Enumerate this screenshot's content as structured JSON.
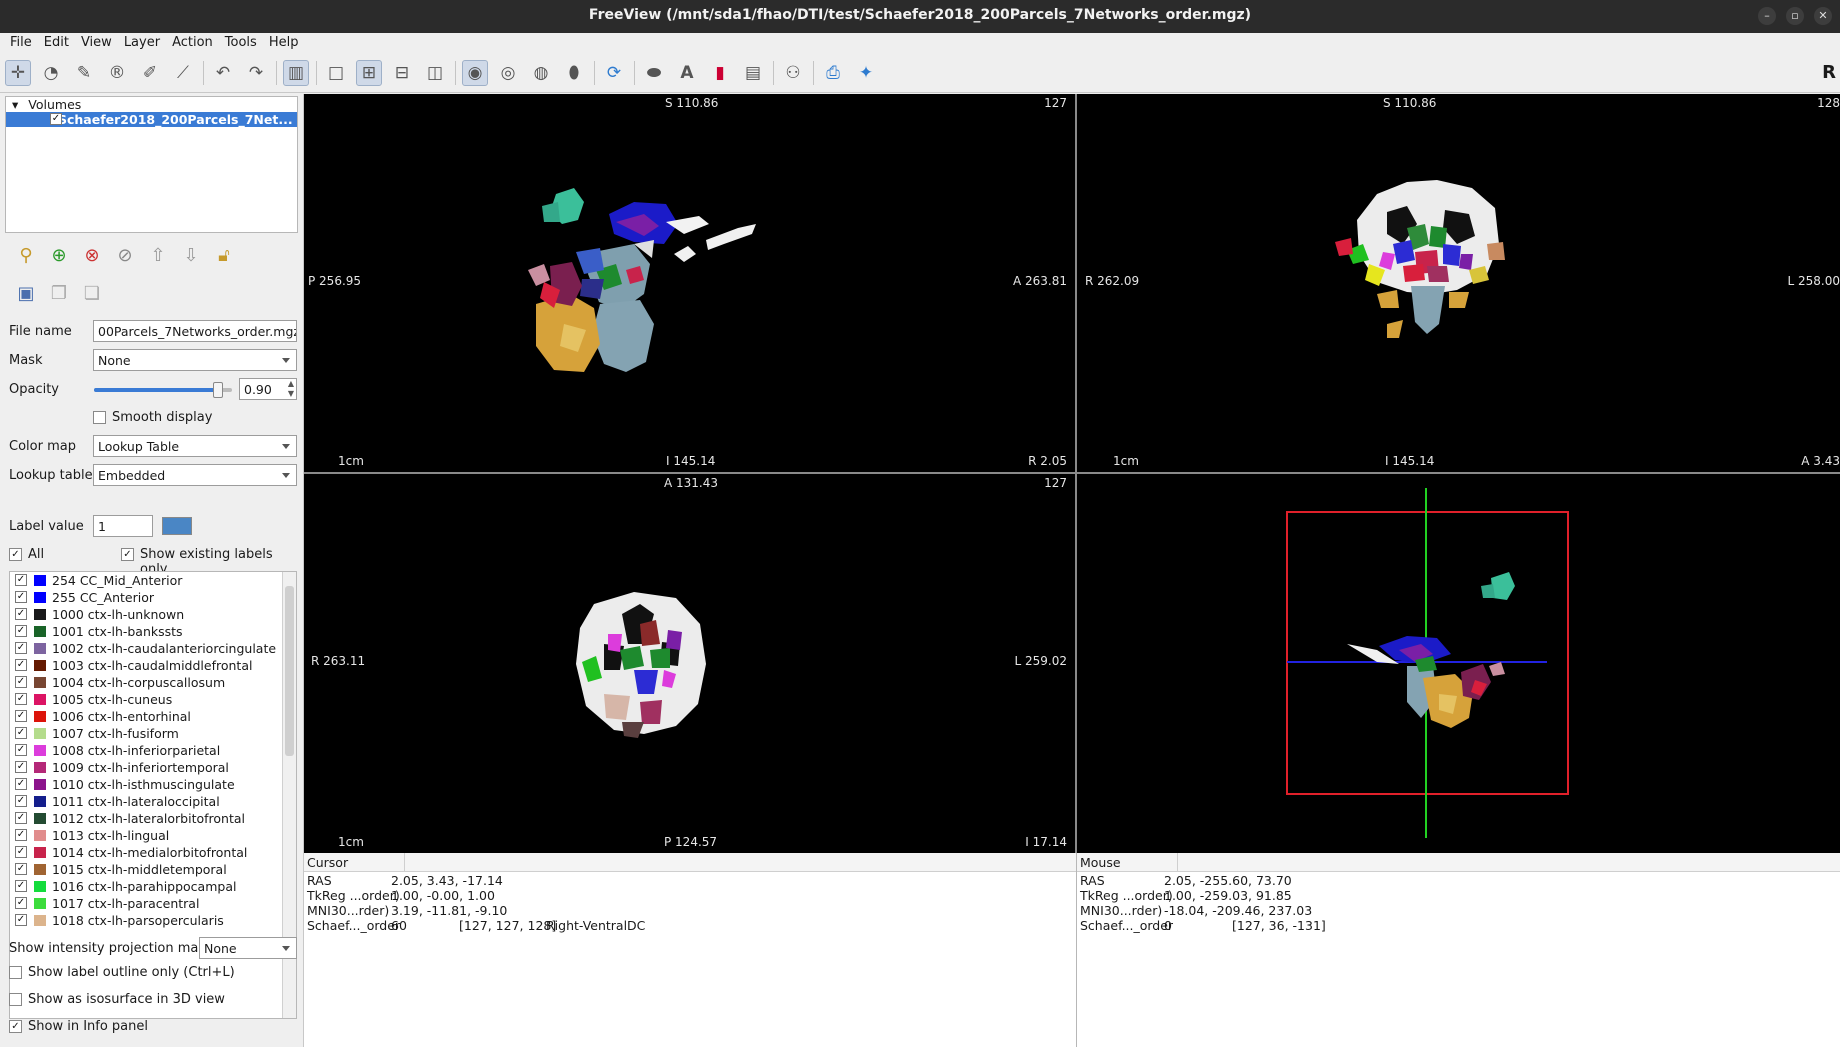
{
  "window": {
    "title": "FreeView (/mnt/sda1/fhao/DTI/test/Schaefer2018_200Parcels_7Networks_order.mgz)"
  },
  "menu": [
    "File",
    "Edit",
    "View",
    "Layer",
    "Action",
    "Tools",
    "Help"
  ],
  "toolbar": {
    "right_label": "R"
  },
  "layers": {
    "group": "Volumes",
    "selected": "Schaefer2018_200Parcels_7Net..."
  },
  "props": {
    "file_name_label": "File name",
    "file_name": "00Parcels_7Networks_order.mgz",
    "mask_label": "Mask",
    "mask": "None",
    "opacity_label": "Opacity",
    "opacity": "0.90",
    "opacity_fraction": 0.9,
    "smooth_label": "Smooth display",
    "colormap_label": "Color map",
    "colormap": "Lookup Table",
    "lut_label": "Lookup table",
    "lut": "Embedded",
    "label_value_label": "Label value",
    "label_value": "1",
    "label_color": "#4a86c5",
    "all_label": "All",
    "existing_only_label": "Show existing labels only",
    "projection_label": "Show intensity projection map",
    "projection": "None",
    "outline_label": "Show label outline only (Ctrl+L)",
    "iso_label": "Show as isosurface in 3D view",
    "info_panel_label": "Show in Info panel"
  },
  "labels": [
    {
      "text": "254 CC_Mid_Anterior",
      "color": "#0000ff"
    },
    {
      "text": "255 CC_Anterior",
      "color": "#0000ff"
    },
    {
      "text": "1000 ctx-lh-unknown",
      "color": "#19191a"
    },
    {
      "text": "1001 ctx-lh-bankssts",
      "color": "#196428"
    },
    {
      "text": "1002 ctx-lh-caudalanteriorcingulate",
      "color": "#7d64a0"
    },
    {
      "text": "1003 ctx-lh-caudalmiddlefrontal",
      "color": "#641900"
    },
    {
      "text": "1004 ctx-lh-corpuscallosum",
      "color": "#784632"
    },
    {
      "text": "1005 ctx-lh-cuneus",
      "color": "#dc1464"
    },
    {
      "text": "1006 ctx-lh-entorhinal",
      "color": "#dc140a"
    },
    {
      "text": "1007 ctx-lh-fusiform",
      "color": "#b4dc8c"
    },
    {
      "text": "1008 ctx-lh-inferiorparietal",
      "color": "#dc3cdc"
    },
    {
      "text": "1009 ctx-lh-inferiortemporal",
      "color": "#b42878"
    },
    {
      "text": "1010 ctx-lh-isthmuscingulate",
      "color": "#8c148c"
    },
    {
      "text": "1011 ctx-lh-lateraloccipital",
      "color": "#141e8c"
    },
    {
      "text": "1012 ctx-lh-lateralorbitofrontal",
      "color": "#234b32"
    },
    {
      "text": "1013 ctx-lh-lingual",
      "color": "#e18c8c"
    },
    {
      "text": "1014 ctx-lh-medialorbitofrontal",
      "color": "#c8234b"
    },
    {
      "text": "1015 ctx-lh-middletemporal",
      "color": "#a06432"
    },
    {
      "text": "1016 ctx-lh-parahippocampal",
      "color": "#14dc3c"
    },
    {
      "text": "1017 ctx-lh-paracentral",
      "color": "#3cdc3c"
    },
    {
      "text": "1018 ctx-lh-parsopercularis",
      "color": "#dcb48c"
    }
  ],
  "views": {
    "sagittal": {
      "top": "S 110.86",
      "slice": "127",
      "left": "P 256.95",
      "right": "A 263.81",
      "bottom": "I 145.14",
      "br": "R 2.05",
      "scale": "1cm"
    },
    "coronal": {
      "top": "S 110.86",
      "slice": "128",
      "left": "R 262.09",
      "right": "L 258.00",
      "bottom": "I 145.14",
      "br": "A 3.43",
      "scale": "1cm"
    },
    "axial": {
      "top": "A 131.43",
      "slice": "127",
      "left": "R 263.11",
      "right": "L 259.02",
      "bottom": "P 124.57",
      "br": "I 17.14",
      "scale": "1cm"
    }
  },
  "info": {
    "cursor": {
      "title": "Cursor",
      "rows": [
        {
          "k": "RAS",
          "v": "2.05, 3.43, -17.14",
          "v2": "",
          "v3": ""
        },
        {
          "k": "TkReg ...order)",
          "v": "1.00, -0.00, 1.00",
          "v2": "",
          "v3": ""
        },
        {
          "k": "MNI30...rder)",
          "v": "3.19, -11.81, -9.10",
          "v2": "",
          "v3": ""
        },
        {
          "k": "Schaef..._order",
          "v": "60",
          "v2": "[127, 127, 128]",
          "v3": "Right-VentralDC"
        }
      ]
    },
    "mouse": {
      "title": "Mouse",
      "rows": [
        {
          "k": "RAS",
          "v": "2.05, -255.60, 73.70",
          "v2": "",
          "v3": ""
        },
        {
          "k": "TkReg ...order)",
          "v": "1.00, -259.03, 91.85",
          "v2": "",
          "v3": ""
        },
        {
          "k": "MNI30...rder)",
          "v": "-18.04, -209.46, 237.03",
          "v2": "",
          "v3": ""
        },
        {
          "k": "Schaef..._order",
          "v": "0",
          "v2": "[127, 36, -131]",
          "v3": ""
        }
      ]
    }
  }
}
